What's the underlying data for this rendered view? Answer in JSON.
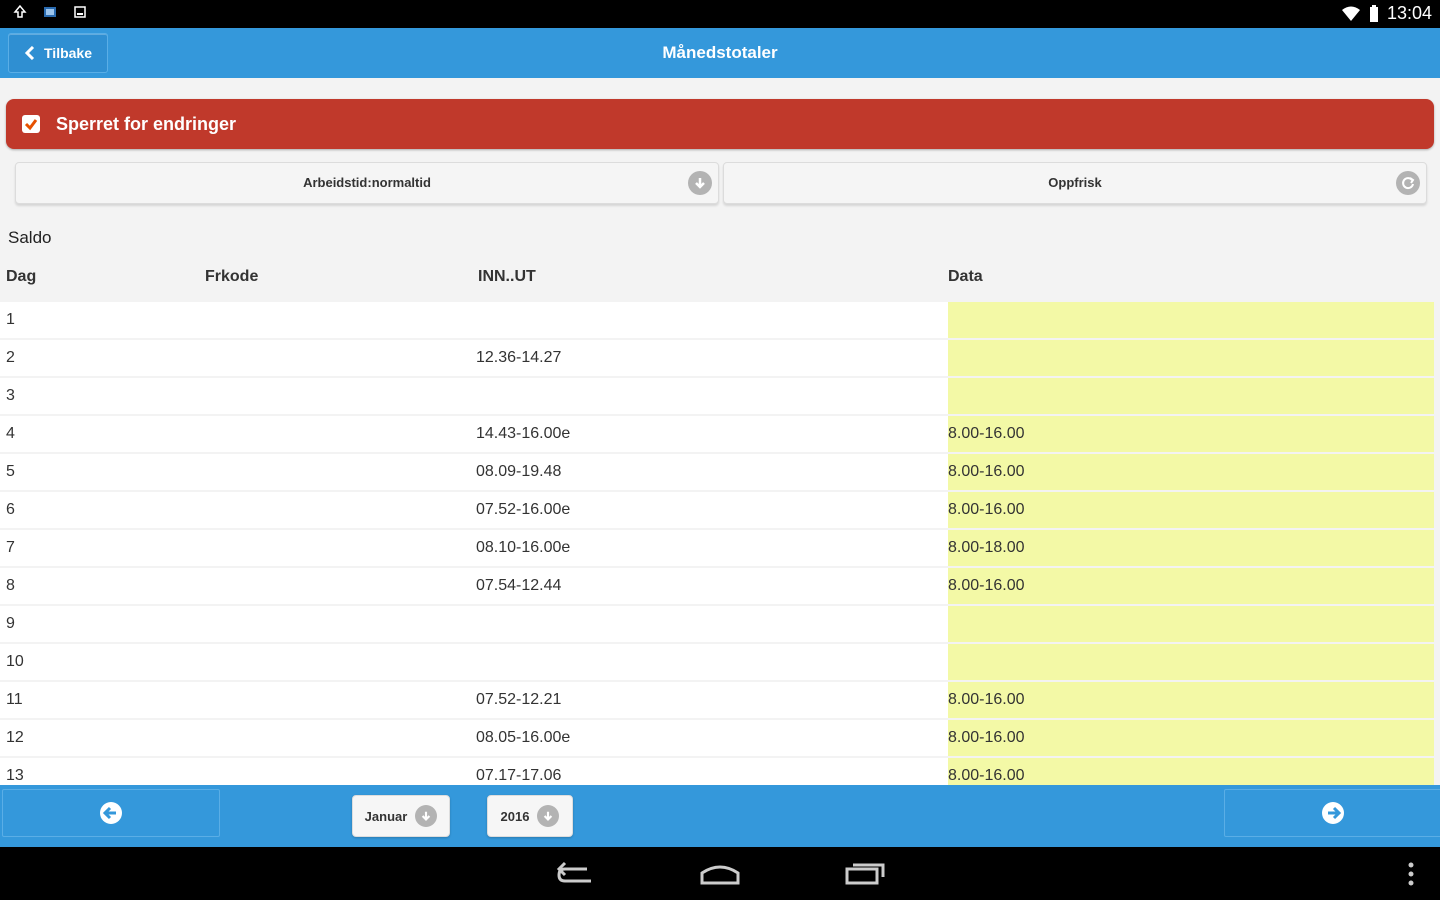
{
  "status_bar": {
    "time": "13:04"
  },
  "header": {
    "back_label": "Tilbake",
    "title": "Månedstotaler"
  },
  "locked": {
    "label": "Sperret for endringer",
    "checked": true
  },
  "selectors": {
    "worktime": "Arbeidstid:normaltid",
    "refresh": "Oppfrisk"
  },
  "section_title": "Saldo",
  "table": {
    "headers": {
      "day": "Dag",
      "frkode": "Frkode",
      "inout": "INN..UT",
      "data": "Data"
    },
    "rows": [
      {
        "day": "1",
        "inout": "",
        "data": ""
      },
      {
        "day": "2",
        "inout": "12.36-14.27",
        "data": ""
      },
      {
        "day": "3",
        "inout": "",
        "data": ""
      },
      {
        "day": "4",
        "inout": "14.43-16.00e",
        "data": "8.00-16.00"
      },
      {
        "day": "5",
        "inout": "08.09-19.48",
        "data": "8.00-16.00"
      },
      {
        "day": "6",
        "inout": "07.52-16.00e",
        "data": "8.00-16.00"
      },
      {
        "day": "7",
        "inout": "08.10-16.00e",
        "data": "8.00-18.00"
      },
      {
        "day": "8",
        "inout": "07.54-12.44",
        "data": "8.00-16.00"
      },
      {
        "day": "9",
        "inout": "",
        "data": ""
      },
      {
        "day": "10",
        "inout": "",
        "data": ""
      },
      {
        "day": "11",
        "inout": "07.52-12.21",
        "data": "8.00-16.00"
      },
      {
        "day": "12",
        "inout": "08.05-16.00e",
        "data": "8.00-16.00"
      },
      {
        "day": "13",
        "inout": "07.17-17.06",
        "data": "8.00-16.00"
      }
    ]
  },
  "footer": {
    "month": "Januar",
    "year": "2016"
  },
  "colors": {
    "primary": "#3498db",
    "locked": "#c0392b",
    "data_bg": "#f3f9a6"
  }
}
